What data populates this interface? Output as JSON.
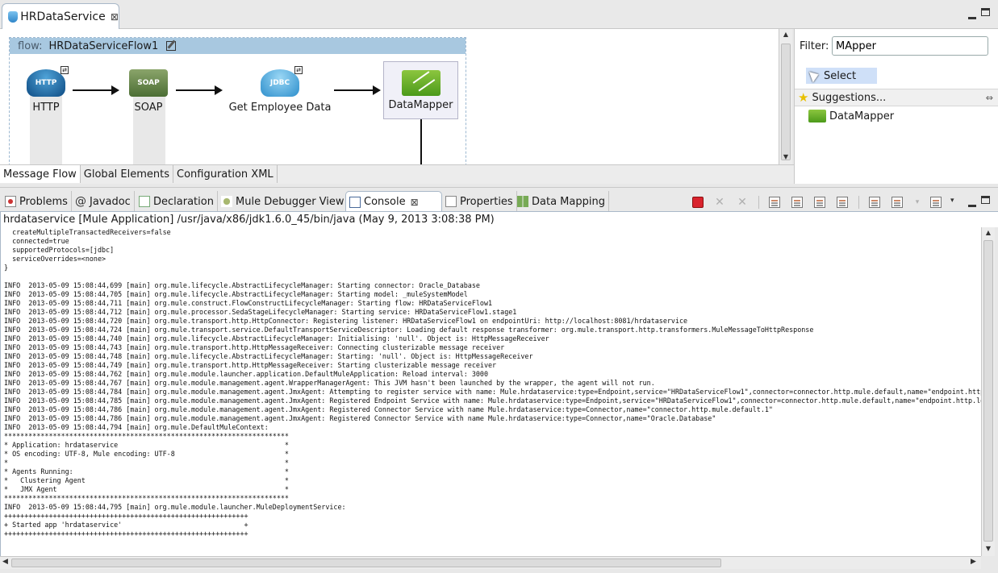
{
  "editor": {
    "tab_label": "HRDataService",
    "flow_keyword": "flow:",
    "flow_name": "HRDataServiceFlow1",
    "nodes": [
      {
        "label": "HTTP",
        "icon": "http-endpoint-icon",
        "badge": "HTTP"
      },
      {
        "label": "SOAP",
        "icon": "soap-component-icon",
        "badge": "SOAP"
      },
      {
        "label": "Get Employee Data",
        "icon": "jdbc-endpoint-icon",
        "badge": "JDBC"
      },
      {
        "label": "DataMapper",
        "icon": "datamapper-icon"
      }
    ],
    "canvas_tabs": [
      "Message Flow",
      "Global Elements",
      "Configuration XML"
    ]
  },
  "palette": {
    "filter_label": "Filter:",
    "filter_value": "MApper",
    "select_label": "Select",
    "suggestions_label": "Suggestions...",
    "suggestion_items": [
      "DataMapper"
    ]
  },
  "views": {
    "tabs": [
      "Problems",
      "Javadoc",
      "Declaration",
      "Mule Debugger View",
      "Console",
      "Properties",
      "Data Mapping"
    ],
    "active": "Console"
  },
  "console": {
    "title": "hrdataservice [Mule Application] /usr/java/x86/jdk1.6.0_45/bin/java (May 9, 2013 3:08:38 PM)",
    "lines": [
      "  createMultipleTransactedReceivers=false",
      "  connected=true",
      "  supportedProtocols=[jdbc]",
      "  serviceOverrides=<none>",
      "}",
      "",
      "INFO  2013-05-09 15:08:44,699 [main] org.mule.lifecycle.AbstractLifecycleManager: Starting connector: Oracle_Database",
      "INFO  2013-05-09 15:08:44,705 [main] org.mule.lifecycle.AbstractLifecycleManager: Starting model: _muleSystemModel",
      "INFO  2013-05-09 15:08:44,711 [main] org.mule.construct.FlowConstructLifecycleManager: Starting flow: HRDataServiceFlow1",
      "INFO  2013-05-09 15:08:44,712 [main] org.mule.processor.SedaStageLifecycleManager: Starting service: HRDataServiceFlow1.stage1",
      "INFO  2013-05-09 15:08:44,720 [main] org.mule.transport.http.HttpConnector: Registering listener: HRDataServiceFlow1 on endpointUri: http://localhost:8081/hrdataservice",
      "INFO  2013-05-09 15:08:44,724 [main] org.mule.transport.service.DefaultTransportServiceDescriptor: Loading default response transformer: org.mule.transport.http.transformers.MuleMessageToHttpResponse",
      "INFO  2013-05-09 15:08:44,740 [main] org.mule.lifecycle.AbstractLifecycleManager: Initialising: 'null'. Object is: HttpMessageReceiver",
      "INFO  2013-05-09 15:08:44,743 [main] org.mule.transport.http.HttpMessageReceiver: Connecting clusterizable message receiver",
      "INFO  2013-05-09 15:08:44,748 [main] org.mule.lifecycle.AbstractLifecycleManager: Starting: 'null'. Object is: HttpMessageReceiver",
      "INFO  2013-05-09 15:08:44,749 [main] org.mule.transport.http.HttpMessageReceiver: Starting clusterizable message receiver",
      "INFO  2013-05-09 15:08:44,762 [main] org.mule.module.launcher.application.DefaultMuleApplication: Reload interval: 3000",
      "INFO  2013-05-09 15:08:44,767 [main] org.mule.module.management.agent.WrapperManagerAgent: This JVM hasn't been launched by the wrapper, the agent will not run.",
      "INFO  2013-05-09 15:08:44,784 [main] org.mule.module.management.agent.JmxAgent: Attempting to register service with name: Mule.hrdataservice:type=Endpoint,service=\"HRDataServiceFlow1\",connector=connector.http.mule.default,name=\"endpoint.http.",
      "INFO  2013-05-09 15:08:44,785 [main] org.mule.module.management.agent.JmxAgent: Registered Endpoint Service with name: Mule.hrdataservice:type=Endpoint,service=\"HRDataServiceFlow1\",connector=connector.http.mule.default,name=\"endpoint.http.loc",
      "INFO  2013-05-09 15:08:44,786 [main] org.mule.module.management.agent.JmxAgent: Registered Connector Service with name Mule.hrdataservice:type=Connector,name=\"connector.http.mule.default.1\"",
      "INFO  2013-05-09 15:08:44,786 [main] org.mule.module.management.agent.JmxAgent: Registered Connector Service with name Mule.hrdataservice:type=Connector,name=\"Oracle.Database\"",
      "INFO  2013-05-09 15:08:44,794 [main] org.mule.DefaultMuleContext:",
      "**********************************************************************",
      "* Application: hrdataservice                                         *",
      "* OS encoding: UTF-8, Mule encoding: UTF-8                           *",
      "*                                                                    *",
      "* Agents Running:                                                    *",
      "*   Clustering Agent                                                 *",
      "*   JMX Agent                                                        *",
      "**********************************************************************",
      "INFO  2013-05-09 15:08:44,795 [main] org.mule.module.launcher.MuleDeploymentService:",
      "++++++++++++++++++++++++++++++++++++++++++++++++++++++++++++",
      "+ Started app 'hrdataservice'                              +",
      "++++++++++++++++++++++++++++++++++++++++++++++++++++++++++++"
    ]
  }
}
